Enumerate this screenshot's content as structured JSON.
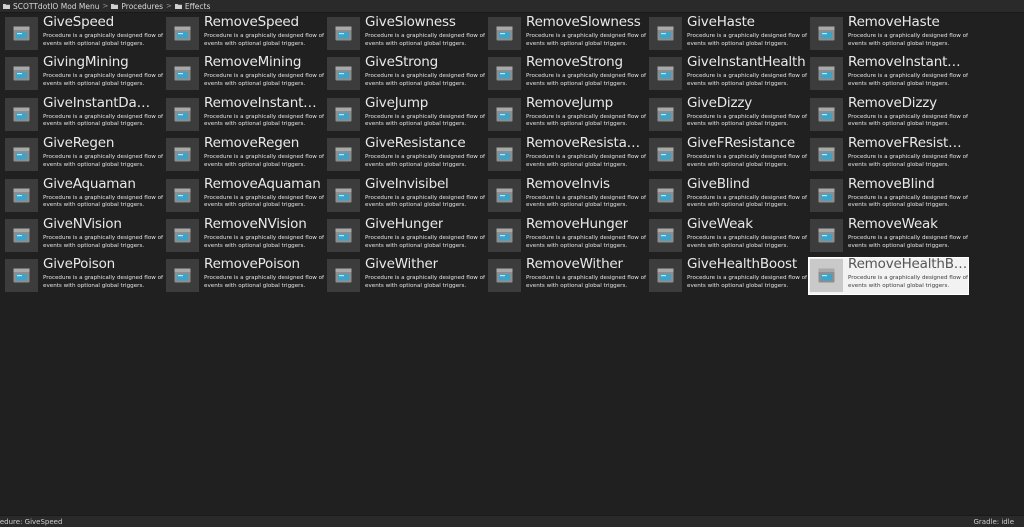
{
  "breadcrumb": {
    "items": [
      "SCOTTdotIO Mod Menu",
      "Procedures",
      "Effects"
    ],
    "separator": ">"
  },
  "tile_description": "Procedure is a graphically designed flow of events with optional global triggers.",
  "tiles": [
    "GiveSpeed",
    "RemoveSpeed",
    "GiveSlowness",
    "RemoveSlowness",
    "GiveHaste",
    "RemoveHaste",
    "GivingMining",
    "RemoveMining",
    "GiveStrong",
    "RemoveStrong",
    "GiveInstantHealth",
    "RemoveInstantHe...",
    "GiveInstantDamage",
    "RemoveInstantDa...",
    "GiveJump",
    "RemoveJump",
    "GiveDizzy",
    "RemoveDizzy",
    "GiveRegen",
    "RemoveRegen",
    "GiveResistance",
    "RemoveResistance",
    "GiveFResistance",
    "RemoveFResistance",
    "GiveAquaman",
    "RemoveAquaman",
    "GiveInvisibel",
    "RemoveInvis",
    "GiveBlind",
    "RemoveBlind",
    "GiveNVision",
    "RemoveNVision",
    "GiveHunger",
    "RemoveHunger",
    "GiveWeak",
    "RemoveWeak",
    "GivePoison",
    "RemovePoison",
    "GiveWither",
    "RemoveWither",
    "GiveHealthBoost",
    "RemoveHealthBoost"
  ],
  "selected_tile": "RemoveHealthBoost",
  "statusbar": {
    "left": "cedure: GiveSpeed",
    "right": "Gradle: idle"
  },
  "icons": {
    "tile_thumbnail": "procedure-block-icon",
    "breadcrumb": "folder-icon"
  },
  "colors": {
    "background": "#202020",
    "selected_tile": "#f2f2f2",
    "icon_blue": "#3fa3c8"
  }
}
